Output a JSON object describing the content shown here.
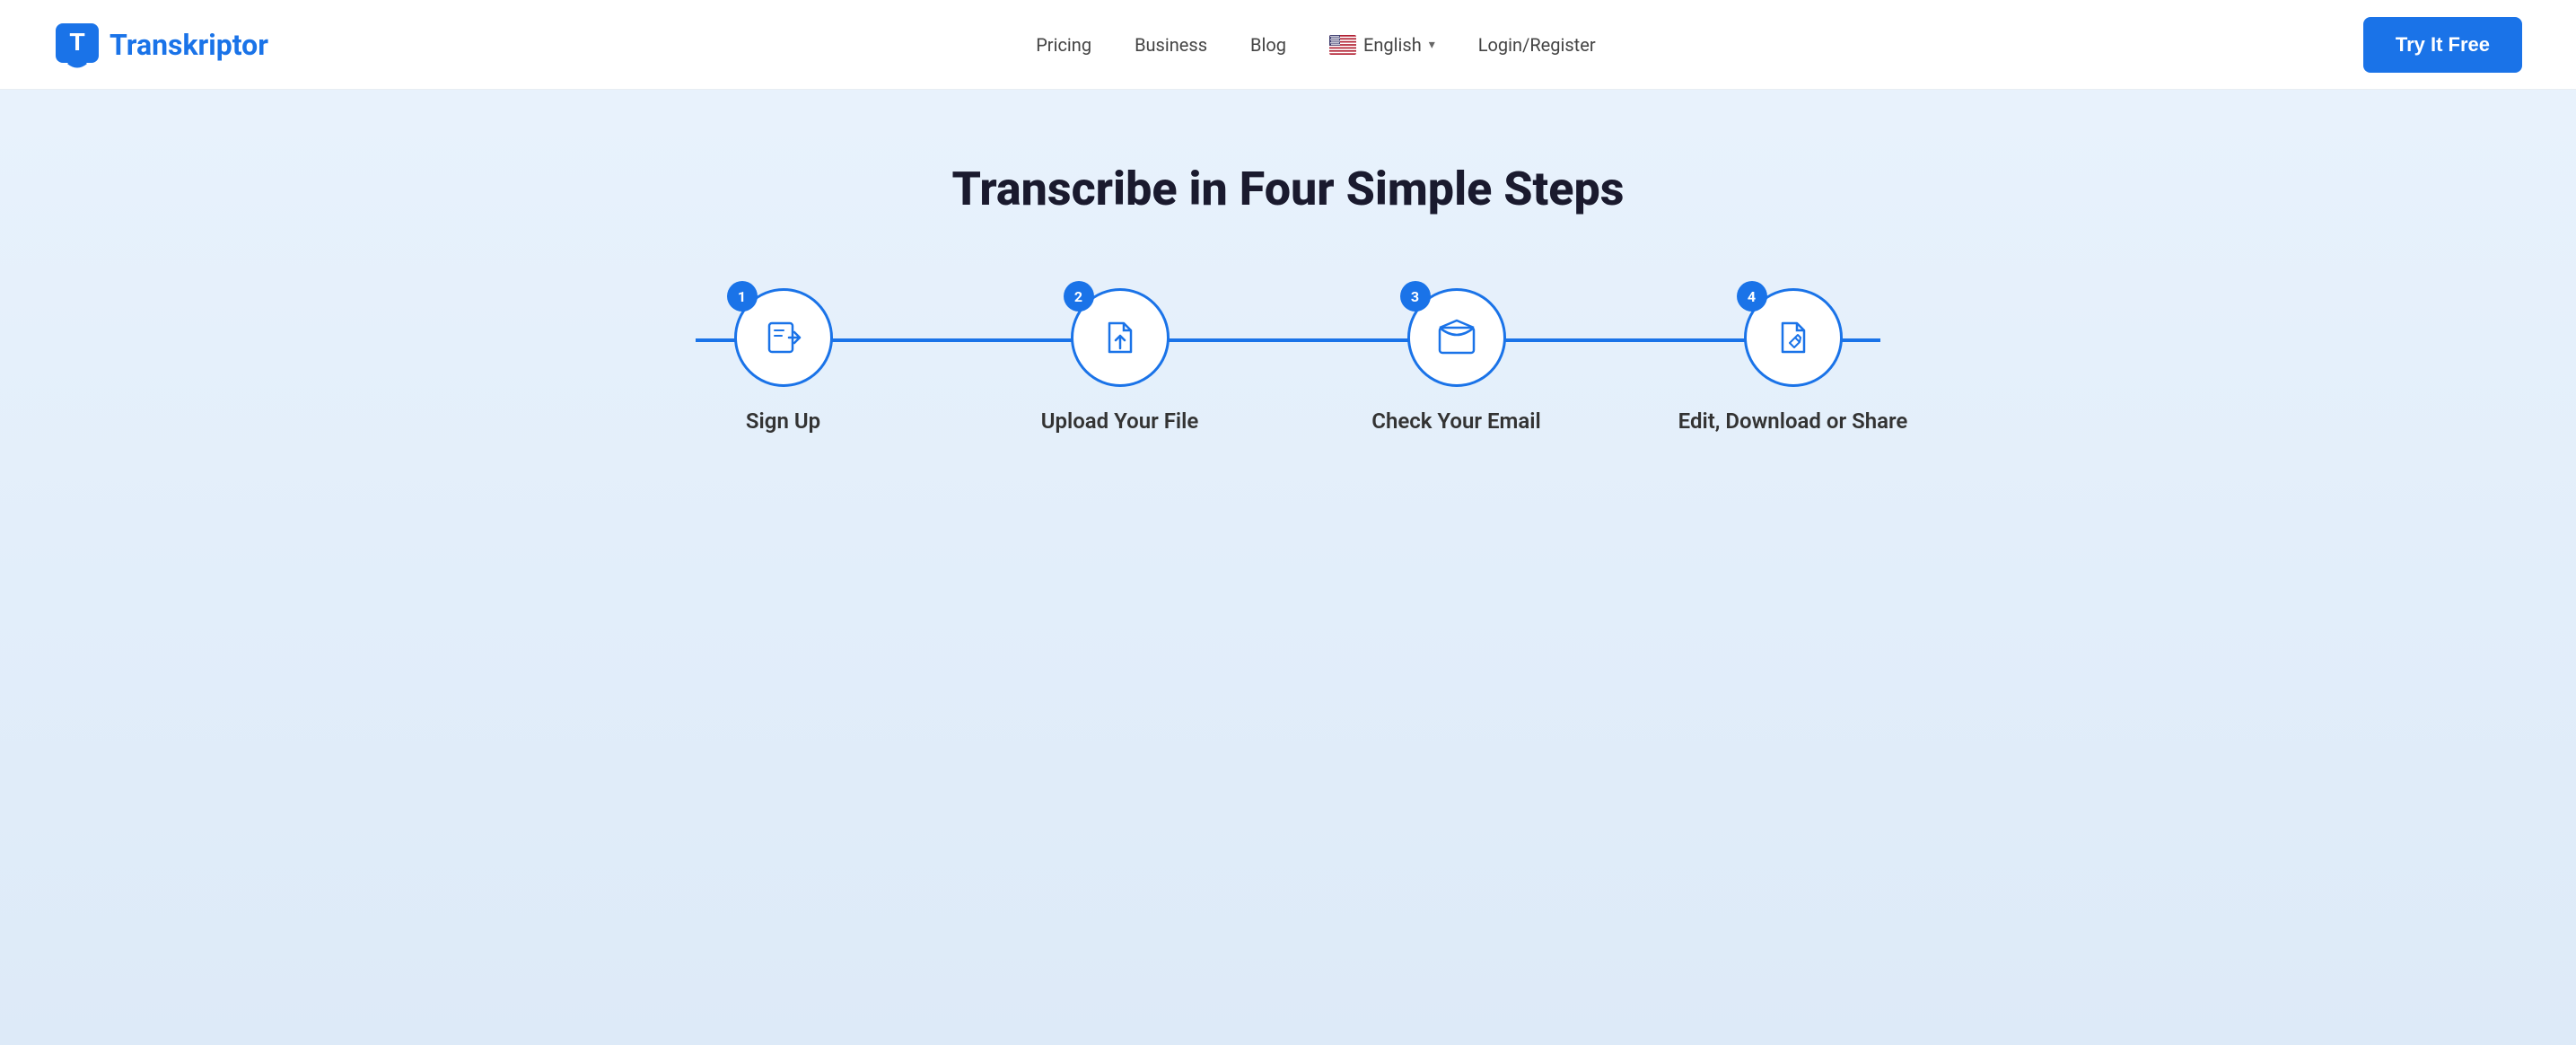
{
  "header": {
    "logo_text_prefix": "T",
    "logo_text_rest": "ranskriptor",
    "nav": {
      "pricing_label": "Pricing",
      "business_label": "Business",
      "blog_label": "Blog",
      "language_label": "English",
      "login_label": "Login/Register",
      "try_free_label": "Try It Free"
    }
  },
  "main": {
    "title": "Transcribe in Four Simple Steps",
    "steps": [
      {
        "number": "1",
        "label": "Sign Up",
        "icon_name": "sign-in-icon"
      },
      {
        "number": "2",
        "label": "Upload Your File",
        "icon_name": "upload-file-icon"
      },
      {
        "number": "3",
        "label": "Check Your Email",
        "icon_name": "email-icon"
      },
      {
        "number": "4",
        "label": "Edit, Download or Share",
        "icon_name": "edit-document-icon"
      }
    ]
  }
}
